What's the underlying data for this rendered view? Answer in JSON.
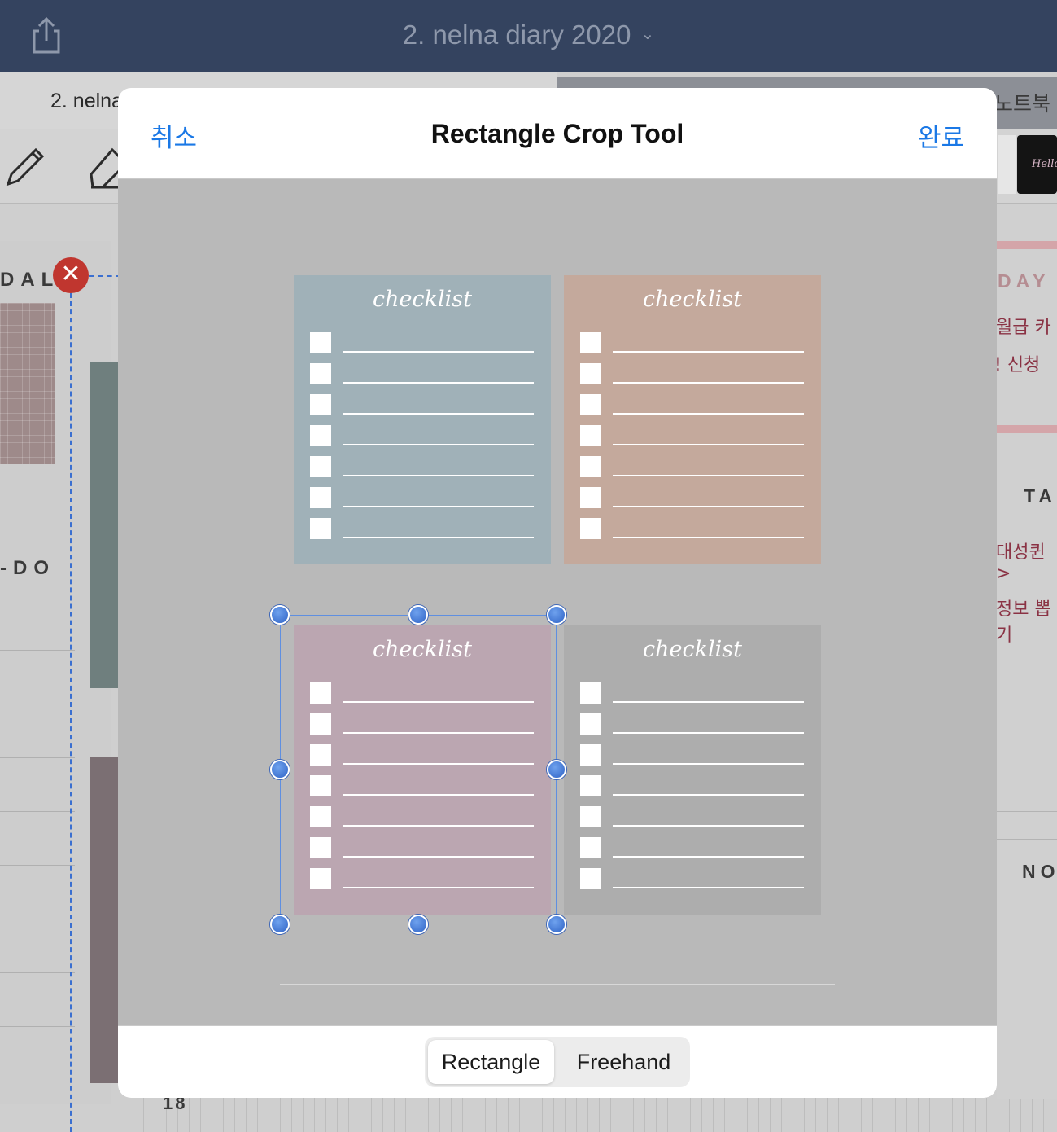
{
  "app": {
    "title": "2. nelna diary 2020",
    "tab_left": "2. nelna",
    "tab_right": "노트북",
    "thumb_text": "Hello"
  },
  "background": {
    "labels": {
      "dal": "DAL",
      "todo": "-DO",
      "day": "DAY",
      "ta": "TA",
      "no": "NO",
      "number": "18"
    },
    "handwriting": [
      "월급 카",
      "!  신청",
      "대성퀸 >",
      "정보 뽑기"
    ],
    "close_symbol": "✕"
  },
  "modal": {
    "title": "Rectangle Crop Tool",
    "cancel": "취소",
    "done": "완료",
    "segments": [
      "Rectangle",
      "Freehand"
    ],
    "selected_segment": "Rectangle"
  },
  "cards": [
    {
      "title": "checklist",
      "color": "#a0b1b8",
      "rows": 7
    },
    {
      "title": "checklist",
      "color": "#c4a99c",
      "rows": 7
    },
    {
      "title": "checklist",
      "color": "#bba6b1",
      "rows": 7
    },
    {
      "title": "checklist",
      "color": "#adadad",
      "rows": 7
    }
  ],
  "colors": {
    "accent": "#1a78e6",
    "topbar": "#34435f",
    "close_red": "#c0362f",
    "handle_blue": "#3a72d4"
  },
  "icons": [
    "share-icon",
    "pen-icon",
    "eraser-icon",
    "close-icon",
    "chevron-down-icon"
  ]
}
